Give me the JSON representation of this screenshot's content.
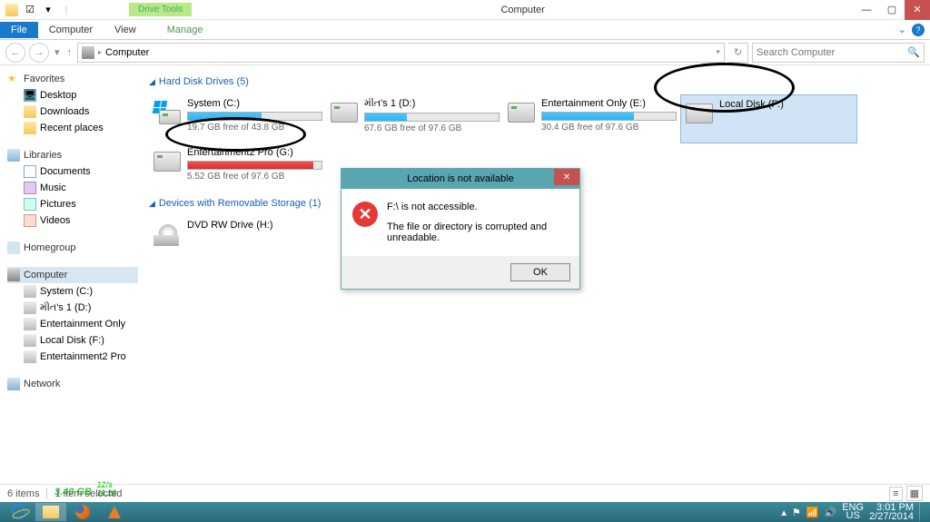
{
  "window": {
    "title": "Computer",
    "context_tab": "Drive Tools"
  },
  "ribbon": {
    "file": "File",
    "tabs": [
      "Computer",
      "View"
    ],
    "ctx": "Manage"
  },
  "address": {
    "crumb": "Computer",
    "search_placeholder": "Search Computer"
  },
  "nav": {
    "fav_head": "Favorites",
    "fav": [
      {
        "l": "Desktop"
      },
      {
        "l": "Downloads"
      },
      {
        "l": "Recent places"
      }
    ],
    "lib_head": "Libraries",
    "lib": [
      {
        "l": "Documents"
      },
      {
        "l": "Music"
      },
      {
        "l": "Pictures"
      },
      {
        "l": "Videos"
      }
    ],
    "hg": "Homegroup",
    "comp": "Computer",
    "drives": [
      {
        "l": "System (C:)"
      },
      {
        "l": "મીત's 1 (D:)"
      },
      {
        "l": "Entertainment Only"
      },
      {
        "l": "Local Disk (F:)"
      },
      {
        "l": "Entertainment2 Pro"
      }
    ],
    "net": "Network"
  },
  "cats": {
    "hdd": "Hard Disk Drives (5)",
    "rem": "Devices with Removable Storage (1)"
  },
  "drives": [
    {
      "name": "System (C:)",
      "free": "19.7 GB free of 43.8 GB",
      "pct": 55,
      "os": true
    },
    {
      "name": "મીત's 1 (D:)",
      "free": "67.6 GB free of 97.6 GB",
      "pct": 31
    },
    {
      "name": "Entertainment Only (E:)",
      "free": "30.4 GB free of 97.6 GB",
      "pct": 69
    },
    {
      "name": "Local Disk (F:)",
      "free": "",
      "pct": 0,
      "nobar": true,
      "sel": true
    },
    {
      "name": "Entertainment2 Pro (G:)",
      "free": "5.52 GB free of 97.6 GB",
      "pct": 94,
      "red": true
    }
  ],
  "dvd": {
    "name": "DVD RW Drive (H:)"
  },
  "dialog": {
    "title": "Location is not available",
    "msg1": "F:\\ is not accessible.",
    "msg2": "The file or directory is corrupted and unreadable.",
    "ok": "OK"
  },
  "status": {
    "items": "6 items",
    "sel": "1 item selected"
  },
  "overlay": {
    "big": "3.40 GB",
    "top": "12/s",
    "bot": "11.28"
  },
  "tray": {
    "lang1": "ENG",
    "lang2": "US",
    "time": "3:01 PM",
    "date": "2/27/2014"
  }
}
